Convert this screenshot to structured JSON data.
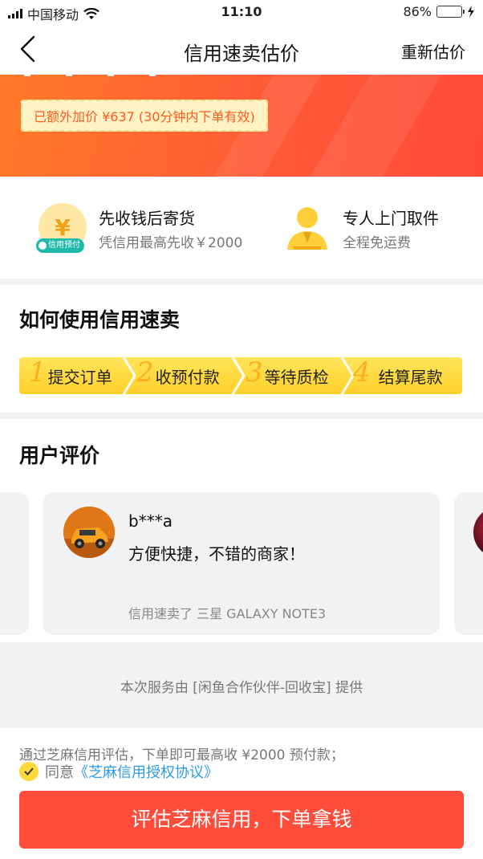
{
  "status_bar": {
    "carrier": "中国移动",
    "time": "11:10",
    "battery_percent": "86%",
    "battery_level": 0.86,
    "icons": [
      "signal-icon",
      "wifi-icon",
      "battery-icon",
      "charging-icon"
    ]
  },
  "nav": {
    "title": "信用速卖估价",
    "right_action": "重新估价",
    "back_icon": "chevron-left-icon"
  },
  "hero": {
    "bonus_text": "已额外加价 ¥637 (30分钟内下单有效)"
  },
  "features": [
    {
      "title": "先收钱后寄货",
      "subtitle": "凭信用最高先收￥2000",
      "icon": "yen-coin-icon",
      "icon_glyph": "¥",
      "badge": "信用预付"
    },
    {
      "title": "专人上门取件",
      "subtitle": "全程免运费",
      "icon": "courier-person-icon"
    }
  ],
  "howto": {
    "title": "如何使用信用速卖",
    "steps": [
      {
        "num": "1",
        "label": "提交订单"
      },
      {
        "num": "2",
        "label": "收预付款"
      },
      {
        "num": "3",
        "label": "等待质检"
      },
      {
        "num": "4",
        "label": "结算尾款"
      }
    ]
  },
  "reviews": {
    "title": "用户评价",
    "items": [
      {
        "user": "b***a",
        "text": "方便快捷，不错的商家！",
        "sold": "信用速卖了 三星 GALAXY NOTE3"
      }
    ]
  },
  "provider_text": "本次服务由 [闲鱼合作伙伴-回收宝] 提供",
  "bottom": {
    "notice": "通过芝麻信用评估，下单即可最高收 ¥2000 预付款；",
    "agree_prefix": "同意",
    "agree_link": "《芝麻信用授权协议》",
    "cta": "评估芝麻信用，下单拿钱"
  },
  "colors": {
    "accent": "#ff4c3b",
    "hero_gradient_start": "#ff7a28",
    "step_yellow": "#ffd02b",
    "link": "#2e9be8"
  }
}
